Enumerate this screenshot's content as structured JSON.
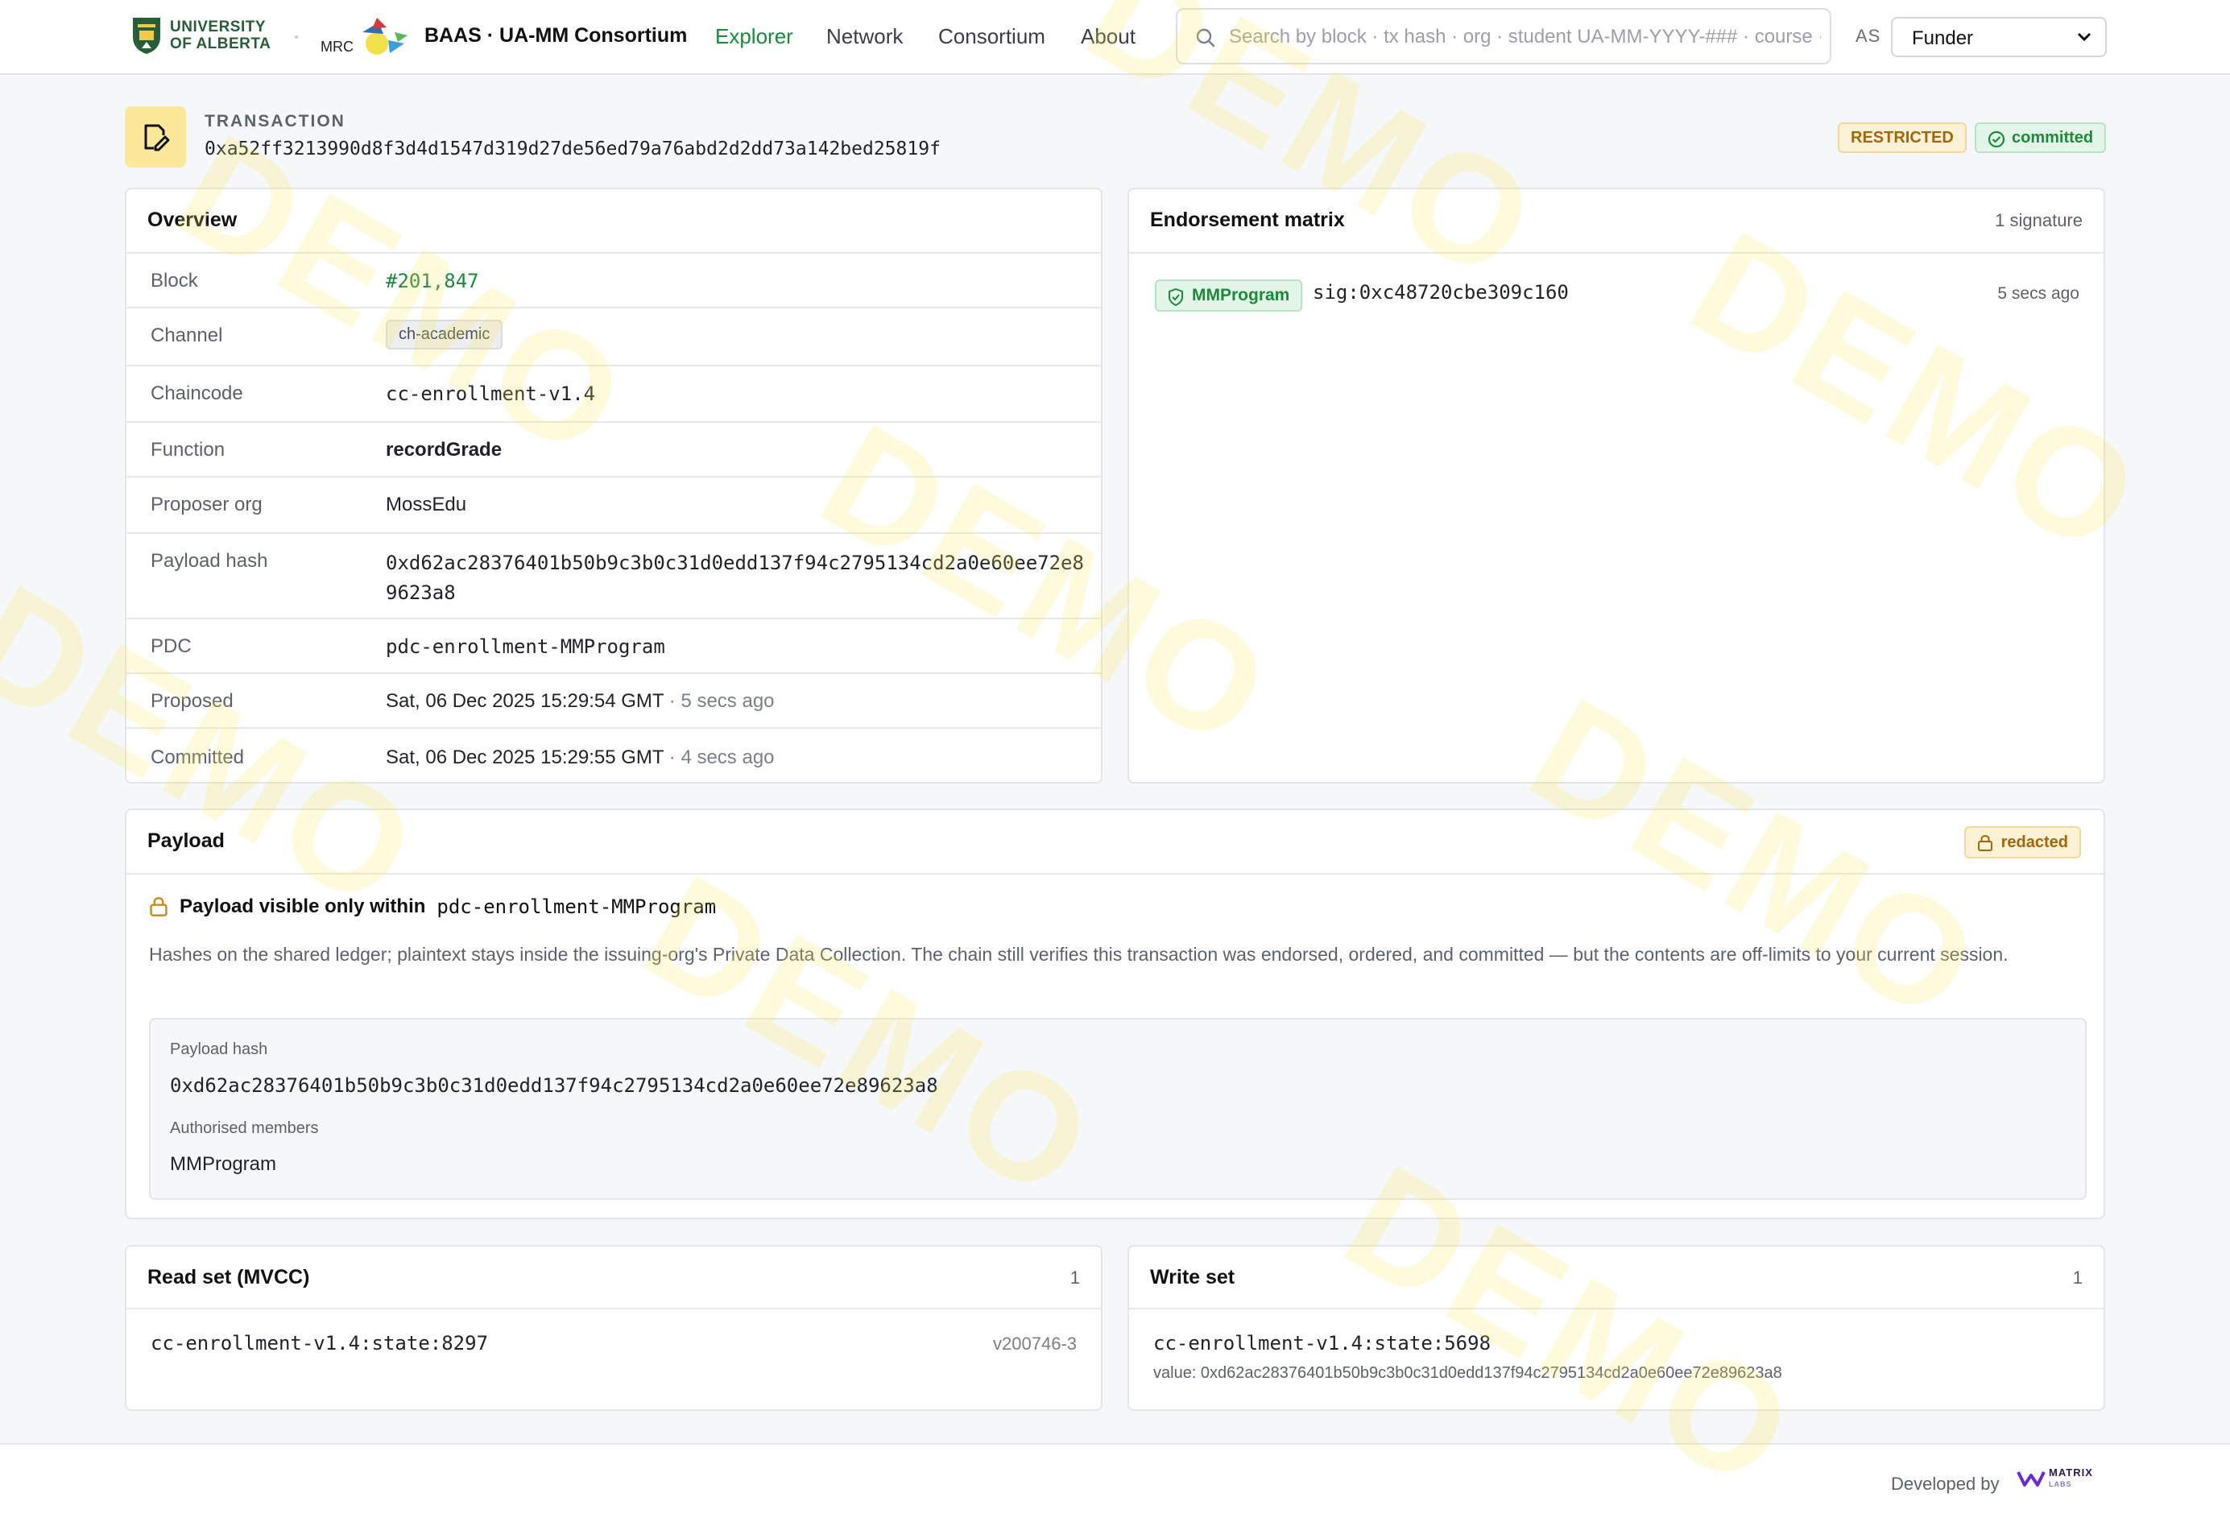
{
  "header": {
    "university_line1": "UNIVERSITY",
    "university_line2": "OF ALBERTA",
    "mrc_logo_text": "MRC",
    "brand": "BAAS · UA-MM Consortium",
    "nav": [
      {
        "label": "Explorer",
        "active": true
      },
      {
        "label": "Network",
        "active": false
      },
      {
        "label": "Consortium",
        "active": false
      },
      {
        "label": "About",
        "active": false
      }
    ],
    "search_placeholder": "Search by block · tx hash · org · student UA-MM-YYYY-### · course · …",
    "as_label": "AS",
    "role_selected": "Funder"
  },
  "transaction": {
    "label": "TRANSACTION",
    "hash": "0xa52ff3213990d8f3d4d1547d319d27de56ed79a76abd2d2dd73a142bed25819f",
    "badge_restricted": "RESTRICTED",
    "badge_status": "committed"
  },
  "overview": {
    "title": "Overview",
    "rows": [
      {
        "key": "Block",
        "value": "#201,847"
      },
      {
        "key": "Channel",
        "value": "ch-academic"
      },
      {
        "key": "Chaincode",
        "value": "cc-enrollment-v1.4"
      },
      {
        "key": "Function",
        "value": "recordGrade"
      },
      {
        "key": "Proposer org",
        "value": "MossEdu"
      },
      {
        "key": "Payload hash",
        "value_line1": "0xd62ac28376401b50b9c3b0c31d0edd137f94c2795134cd2a0e60ee72e8",
        "value_line2": "9623a8"
      },
      {
        "key": "PDC",
        "value": "pdc-enrollment-MMProgram"
      },
      {
        "key": "Proposed",
        "value": "Sat, 06 Dec 2025 15:29:54 GMT",
        "ago": " · 5 secs ago"
      },
      {
        "key": "Committed",
        "value": "Sat, 06 Dec 2025 15:29:55 GMT",
        "ago": " · 4 secs ago"
      }
    ]
  },
  "endorsement": {
    "title": "Endorsement matrix",
    "count": "1 signature",
    "entries": [
      {
        "org": "MMProgram",
        "sig": "sig:0xc48720cbe309c160",
        "ago": "5 secs ago"
      }
    ]
  },
  "payload": {
    "title": "Payload",
    "badge": "redacted",
    "visible_text": "Payload visible only within",
    "visible_pdc": "pdc-enrollment-MMProgram",
    "description": "Hashes on the shared ledger; plaintext stays inside the issuing-org's Private Data Collection. The chain still verifies this transaction was endorsed, ordered, and committed — but the contents are off-limits to your current session.",
    "hash_label": "Payload hash",
    "hash_value": "0xd62ac28376401b50b9c3b0c31d0edd137f94c2795134cd2a0e60ee72e89623a8",
    "members_label": "Authorised members",
    "members_value": "MMProgram"
  },
  "read_set": {
    "title": "Read set (MVCC)",
    "count": "1",
    "entries": [
      {
        "key": "cc-enrollment-v1.4:state:8297",
        "version": "v200746-3"
      }
    ]
  },
  "write_set": {
    "title": "Write set",
    "count": "1",
    "entries": [
      {
        "key": "cc-enrollment-v1.4:state:5698",
        "value": "value: 0xd62ac28376401b50b9c3b0c31d0edd137f94c2795134cd2a0e60ee72e89623a8"
      }
    ]
  },
  "footer": {
    "developed_by": "Developed by",
    "matrix_line1": "MATRIX",
    "matrix_line2": "LABS"
  },
  "watermark": "DEMO",
  "colors": {
    "accent_green": "#1b8a3a",
    "restricted_amber": "#a4660c",
    "ua_green": "#275d38",
    "watermark_yellow": "#fae85a"
  }
}
